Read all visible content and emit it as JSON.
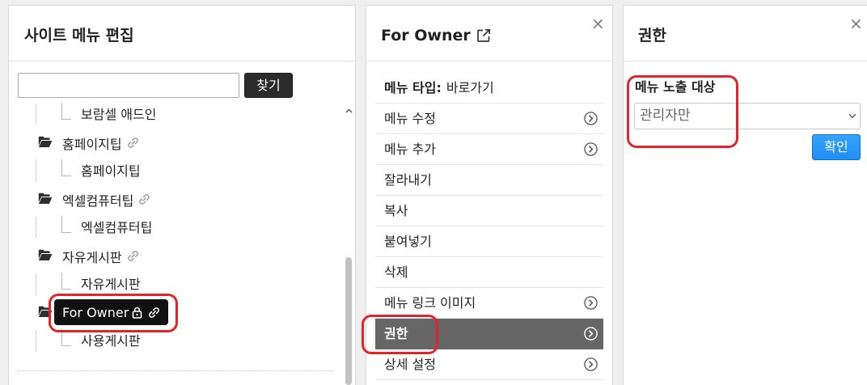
{
  "colors": {
    "page_bg": "#efefef",
    "panel_border": "#d9d9d9",
    "tree_selected_bg": "#111111",
    "menu_selected_bg": "#666666",
    "primary": "#1f8ff2",
    "highlight": "#e3242b"
  },
  "site_menu_editor": {
    "title": "사이트 메뉴 편집",
    "search": {
      "value": "",
      "button_label": "찾기"
    },
    "scroll_icon": "chevron-up-icon",
    "tree": [
      {
        "label": "보람셀 애드인",
        "depth": 2
      },
      {
        "label": "홈페이지팁",
        "depth": 1,
        "icon": "folder-open-icon",
        "badges": [
          "link-icon"
        ]
      },
      {
        "label": "홈페이지팁",
        "depth": 2
      },
      {
        "label": "엑셀컴퓨터팁",
        "depth": 1,
        "icon": "folder-open-icon",
        "badges": [
          "link-icon"
        ]
      },
      {
        "label": "엑셀컴퓨터팁",
        "depth": 2
      },
      {
        "label": "자유게시판",
        "depth": 1,
        "icon": "folder-open-icon",
        "badges": [
          "link-icon"
        ]
      },
      {
        "label": "자유게시판",
        "depth": 2
      },
      {
        "label": "For Owner",
        "depth": 1,
        "icon": "folder-open-icon",
        "badges": [
          "lock-icon",
          "link-icon"
        ],
        "selected": true
      },
      {
        "label": "사용게시판",
        "depth": 2
      }
    ]
  },
  "menu_panel": {
    "title": "For Owner",
    "title_icon": "external-link-icon",
    "close": {
      "icon": "close-icon",
      "glyph": "×"
    },
    "menu_type": {
      "label": "메뉴 타입:",
      "value": "바로가기"
    },
    "items": [
      {
        "label": "메뉴 수정",
        "icon": "chevron-circle-right-icon"
      },
      {
        "label": "메뉴 추가",
        "icon": "chevron-circle-right-icon"
      },
      {
        "label": "잘라내기"
      },
      {
        "label": "복사"
      },
      {
        "label": "붙여넣기"
      },
      {
        "label": "삭제"
      },
      {
        "label": "메뉴 링크 이미지",
        "icon": "chevron-circle-right-icon"
      },
      {
        "label": "권한",
        "icon": "chevron-circle-right-icon",
        "selected": true
      },
      {
        "label": "상세 설정",
        "icon": "chevron-circle-right-icon"
      }
    ]
  },
  "permission_panel": {
    "title": "권한",
    "close": {
      "icon": "close-icon",
      "glyph": "×"
    },
    "field_label": "메뉴 노출 대상",
    "select": {
      "value": "관리자만",
      "icon": "chevron-down-icon"
    },
    "confirm_label": "확인"
  }
}
